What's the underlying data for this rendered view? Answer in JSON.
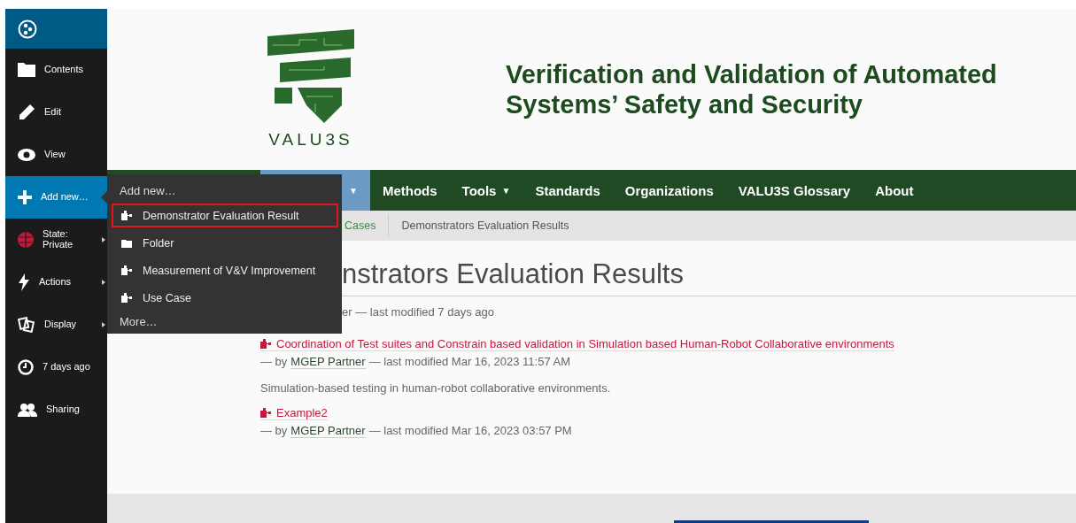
{
  "toolbar": {
    "items": [
      {
        "label": "Contents",
        "selected": false,
        "submenu": false
      },
      {
        "label": "Edit",
        "selected": false,
        "submenu": false
      },
      {
        "label": "View",
        "selected": false,
        "submenu": false
      },
      {
        "label": "Add new…",
        "selected": true,
        "submenu": false
      },
      {
        "label": "State:",
        "sublabel": "Private",
        "selected": false,
        "submenu": true
      },
      {
        "label": "Actions",
        "selected": false,
        "submenu": true
      },
      {
        "label": "Display",
        "selected": false,
        "submenu": true
      },
      {
        "label": "7 days ago",
        "selected": false,
        "submenu": false
      },
      {
        "label": "Sharing",
        "selected": false,
        "submenu": false
      }
    ]
  },
  "add_menu": {
    "heading": "Add new…",
    "items": [
      {
        "label": "Demonstrator Evaluation Result",
        "kind": "type",
        "selected": true
      },
      {
        "label": "Folder",
        "kind": "folder",
        "selected": false
      },
      {
        "label": "Measurement of V&V Improvement",
        "kind": "type",
        "selected": false
      },
      {
        "label": "Use Case",
        "kind": "type",
        "selected": false
      }
    ],
    "more": "More…"
  },
  "header": {
    "logo_text": "VALU3S",
    "title": "Verification and Validation of Automated Systems’ Safety and Security"
  },
  "nav": [
    {
      "caret": "▼",
      "selected": true
    },
    {
      "label": "Methods",
      "selected": false
    },
    {
      "label": "Tools",
      "caret": "▼",
      "selected": false
    },
    {
      "label": "Standards",
      "selected": false
    },
    {
      "label": "Organizations",
      "selected": false
    },
    {
      "label": "VALU3S Glossary",
      "selected": false
    },
    {
      "label": "About",
      "selected": false
    }
  ],
  "breadcrumbs": [
    "Cases",
    "Demonstrators Evaluation Results"
  ],
  "page": {
    "title": "nstrators Evaluation Results",
    "byline": "er — last modified 7 days ago",
    "items": [
      {
        "title": "Coordination of Test suites and Constrain based validation in Simulation based Human-Robot Collaborative environments",
        "by": "— by",
        "author": "MGEP Partner",
        "modified": "— last modified Mar 16, 2023 11:57 AM",
        "description": "Simulation-based testing in human-robot collaborative environments."
      },
      {
        "title": "Example2",
        "by": "— by",
        "author": "MGEP Partner",
        "modified": "— last modified Mar 16, 2023 03:57 PM"
      }
    ]
  }
}
